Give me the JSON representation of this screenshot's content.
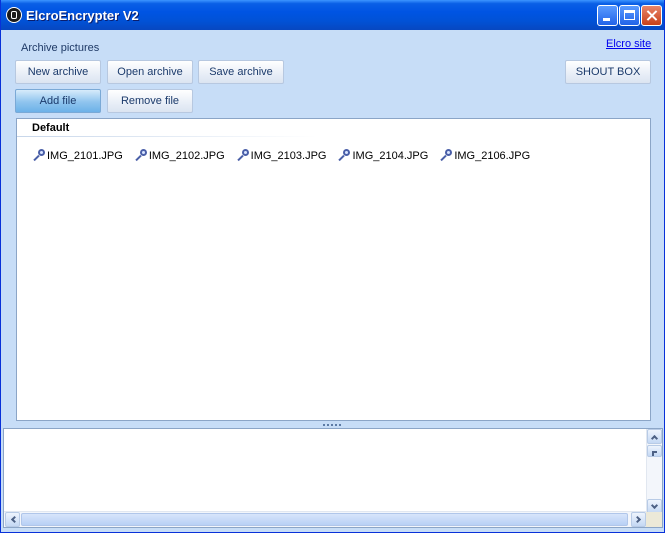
{
  "window": {
    "title": "ElcroEncrypter V2"
  },
  "toolbar": {
    "section_label": "Archive pictures",
    "elcro_site_link": "Elcro site",
    "new_archive": "New archive",
    "open_archive": "Open archive",
    "save_archive": "Save archive",
    "shout_box": "SHOUT BOX",
    "add_file": "Add file",
    "remove_file": "Remove file"
  },
  "archive": {
    "group_name": "Default",
    "files": [
      "IMG_2101.JPG",
      "IMG_2102.JPG",
      "IMG_2103.JPG",
      "IMG_2104.JPG",
      "IMG_2106.JPG"
    ]
  },
  "icons": {
    "file_icon": "key-icon",
    "app_icon": "app-lock-icon"
  },
  "colors": {
    "title_bar": "#0054e3",
    "window_bg": "#c7ddf7",
    "active_button": "#8fc4ee"
  }
}
